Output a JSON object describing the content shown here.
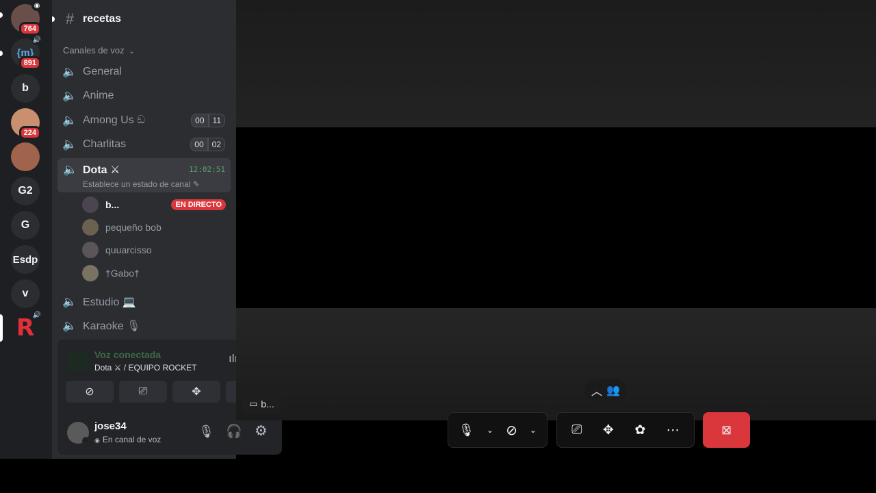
{
  "servers": [
    {
      "label": "",
      "badge": "764",
      "avatar_color": "#6a4e4a"
    },
    {
      "label": "{m}",
      "badge": "891",
      "avatar_color": "#2b2d31"
    },
    {
      "label": "b",
      "badge": "",
      "avatar_color": "#2b2d31"
    },
    {
      "label": "",
      "badge": "224",
      "avatar_color": "#c98f6e"
    },
    {
      "label": "",
      "badge": "",
      "avatar_color": "#a0634b"
    },
    {
      "label": "G2",
      "badge": "",
      "avatar_color": "#2b2d31"
    },
    {
      "label": "G",
      "badge": "",
      "avatar_color": "#2b2d31"
    },
    {
      "label": "Esdp",
      "badge": "",
      "avatar_color": "#2b2d31"
    },
    {
      "label": "v",
      "badge": "",
      "avatar_color": "#2b2d31"
    },
    {
      "label": "R",
      "badge": "",
      "avatar_color": "#e1303c"
    }
  ],
  "channels": {
    "text_channel": "recetas",
    "voice_category": "Canales de voz",
    "items": [
      {
        "name": "General",
        "count_a": "",
        "count_b": ""
      },
      {
        "name": "Anime",
        "count_a": "",
        "count_b": ""
      },
      {
        "name": "Among Us ඞ",
        "count_a": "00",
        "count_b": "11"
      },
      {
        "name": "Charlitas",
        "count_a": "00",
        "count_b": "02"
      }
    ],
    "active": {
      "name": "Dota ⚔",
      "timer": "12:02:51",
      "status_hint": "Establece un estado de canal"
    },
    "users": [
      {
        "name": "b...",
        "live": "EN DIRECTO"
      },
      {
        "name": "pequeño bob",
        "live": ""
      },
      {
        "name": "quuarcisso",
        "live": ""
      },
      {
        "name": "†Gabo†",
        "live": ""
      }
    ],
    "after": [
      {
        "name": "Estudio 💻"
      },
      {
        "name": "Karaoke 🎙"
      }
    ]
  },
  "voice_panel": {
    "status": "Voz conectada",
    "location": "Dota ⚔ / EQUIPO ROCKET"
  },
  "user": {
    "name": "jose34",
    "status": "En canal de voz"
  },
  "stage": {
    "stream_tag": "b..."
  },
  "colors": {
    "accent_red": "#da373c",
    "live_red": "#da373c",
    "rail_bg": "#1e1f22",
    "sidebar_bg": "#2b2d31"
  }
}
